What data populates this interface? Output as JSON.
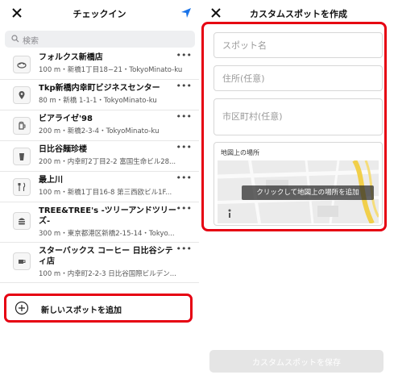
{
  "left": {
    "title": "チェックイン",
    "search_placeholder": "検索",
    "items": [
      {
        "name": "フォルクス新橋店",
        "sub": "100 m・新橋1丁目18−21・TokyoMinato-ku",
        "icon": "food-icon"
      },
      {
        "name": "Tkp新橋内幸町ビジネスセンター",
        "sub": "80 m・新橋 1-1-1・TokyoMinato-ku",
        "icon": "pin-icon"
      },
      {
        "name": "ビアライゼ'98",
        "sub": "200 m・新橋2-3-4・TokyoMinato-ku",
        "icon": "beer-icon"
      },
      {
        "name": "日比谷麺珍楼",
        "sub": "200 m・内幸町2丁目2-2 富国生命ビル28...",
        "icon": "drink-icon"
      },
      {
        "name": "最上川",
        "sub": "100 m・新橋1丁目16-8 第三西欧ビル1F...",
        "icon": "fork-knife-icon"
      },
      {
        "name": "TREE&TREE's -ツリーアンドツリーズ-",
        "sub": "300 m・東京都港区新橋2-15-14・Tokyo...",
        "icon": "burger-icon"
      },
      {
        "name": "スターバックス コーヒー 日比谷シティ店",
        "sub": "100 m・内幸町2-2-3 日比谷国際ビルデン...",
        "icon": "coffee-icon"
      }
    ],
    "more_label": "•••",
    "add_label": "新しいスポットを追加"
  },
  "right": {
    "title": "カスタムスポットを作成",
    "fields": {
      "spot_name": "スポット名",
      "address": "住所(任意)",
      "city": "市区町村(任意)"
    },
    "map_label": "地図上の場所",
    "map_hint": "クリックして地図上の場所を追加",
    "save_label": "カスタムスポットを保存"
  },
  "colors": {
    "accent": "#1a73e8",
    "highlight": "#e60012"
  }
}
